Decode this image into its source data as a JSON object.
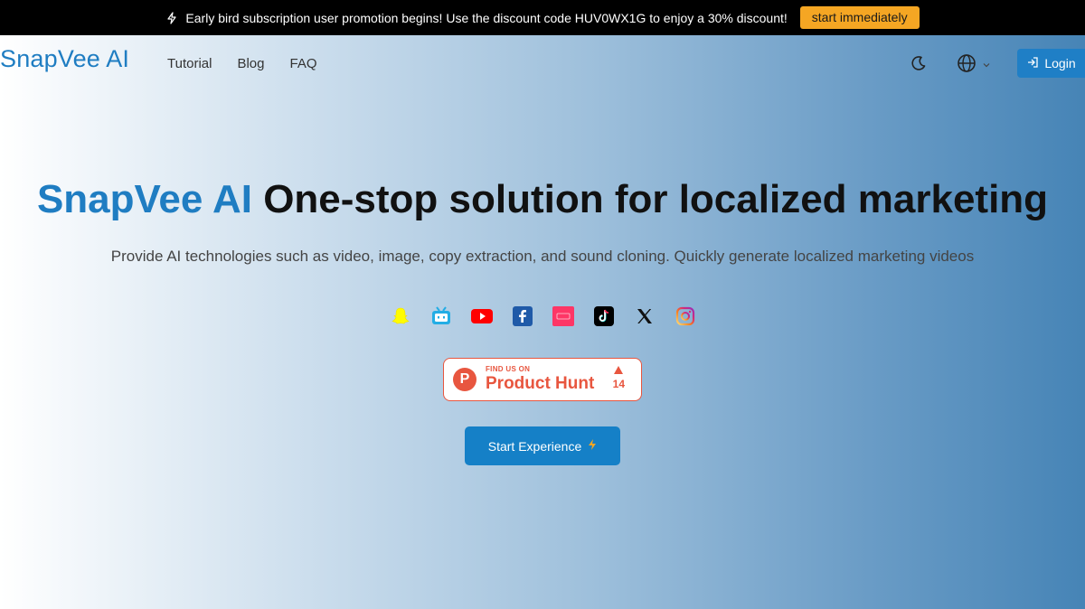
{
  "promo": {
    "text": "Early bird subscription user promotion begins! Use the discount code HUV0WX1G to enjoy a 30% discount!",
    "button_label": "start immediately",
    "button_color": "#f5a623"
  },
  "header": {
    "brand": "SnapVee AI",
    "nav": [
      {
        "label": "Tutorial"
      },
      {
        "label": "Blog"
      },
      {
        "label": "FAQ"
      }
    ],
    "login_label": "Login",
    "icons": [
      "moon-icon",
      "globe-icon",
      "chevron-down-icon",
      "login-icon"
    ]
  },
  "hero": {
    "title_accent": "SnapVee AI",
    "title_rest": " One-stop solution for localized marketing",
    "subtitle": "Provide AI technologies such as video, image, copy extraction, and sound cloning. Quickly generate localized marketing videos",
    "socials": [
      "snapchat-icon",
      "bilibili-icon",
      "youtube-icon",
      "facebook-icon",
      "kuaishou-icon",
      "tiktok-icon",
      "x-icon",
      "instagram-icon"
    ]
  },
  "product_hunt": {
    "small": "FIND US ON",
    "big": "Product Hunt",
    "count": "14",
    "logo_letter": "P"
  },
  "cta": {
    "label": "Start Experience"
  },
  "colors": {
    "brand": "#1f7dc2",
    "product_hunt": "#e8563f"
  }
}
